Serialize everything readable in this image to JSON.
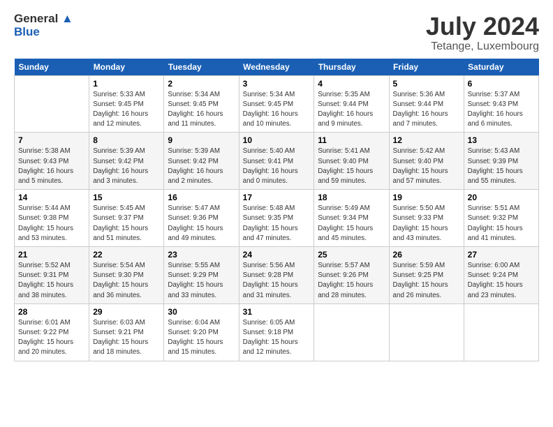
{
  "header": {
    "logo_general": "General",
    "logo_blue": "Blue",
    "title": "July 2024",
    "subtitle": "Tetange, Luxembourg"
  },
  "calendar": {
    "weekdays": [
      "Sunday",
      "Monday",
      "Tuesday",
      "Wednesday",
      "Thursday",
      "Friday",
      "Saturday"
    ],
    "weeks": [
      [
        {
          "day": "",
          "info": ""
        },
        {
          "day": "1",
          "info": "Sunrise: 5:33 AM\nSunset: 9:45 PM\nDaylight: 16 hours\nand 12 minutes."
        },
        {
          "day": "2",
          "info": "Sunrise: 5:34 AM\nSunset: 9:45 PM\nDaylight: 16 hours\nand 11 minutes."
        },
        {
          "day": "3",
          "info": "Sunrise: 5:34 AM\nSunset: 9:45 PM\nDaylight: 16 hours\nand 10 minutes."
        },
        {
          "day": "4",
          "info": "Sunrise: 5:35 AM\nSunset: 9:44 PM\nDaylight: 16 hours\nand 9 minutes."
        },
        {
          "day": "5",
          "info": "Sunrise: 5:36 AM\nSunset: 9:44 PM\nDaylight: 16 hours\nand 7 minutes."
        },
        {
          "day": "6",
          "info": "Sunrise: 5:37 AM\nSunset: 9:43 PM\nDaylight: 16 hours\nand 6 minutes."
        }
      ],
      [
        {
          "day": "7",
          "info": "Sunrise: 5:38 AM\nSunset: 9:43 PM\nDaylight: 16 hours\nand 5 minutes."
        },
        {
          "day": "8",
          "info": "Sunrise: 5:39 AM\nSunset: 9:42 PM\nDaylight: 16 hours\nand 3 minutes."
        },
        {
          "day": "9",
          "info": "Sunrise: 5:39 AM\nSunset: 9:42 PM\nDaylight: 16 hours\nand 2 minutes."
        },
        {
          "day": "10",
          "info": "Sunrise: 5:40 AM\nSunset: 9:41 PM\nDaylight: 16 hours\nand 0 minutes."
        },
        {
          "day": "11",
          "info": "Sunrise: 5:41 AM\nSunset: 9:40 PM\nDaylight: 15 hours\nand 59 minutes."
        },
        {
          "day": "12",
          "info": "Sunrise: 5:42 AM\nSunset: 9:40 PM\nDaylight: 15 hours\nand 57 minutes."
        },
        {
          "day": "13",
          "info": "Sunrise: 5:43 AM\nSunset: 9:39 PM\nDaylight: 15 hours\nand 55 minutes."
        }
      ],
      [
        {
          "day": "14",
          "info": "Sunrise: 5:44 AM\nSunset: 9:38 PM\nDaylight: 15 hours\nand 53 minutes."
        },
        {
          "day": "15",
          "info": "Sunrise: 5:45 AM\nSunset: 9:37 PM\nDaylight: 15 hours\nand 51 minutes."
        },
        {
          "day": "16",
          "info": "Sunrise: 5:47 AM\nSunset: 9:36 PM\nDaylight: 15 hours\nand 49 minutes."
        },
        {
          "day": "17",
          "info": "Sunrise: 5:48 AM\nSunset: 9:35 PM\nDaylight: 15 hours\nand 47 minutes."
        },
        {
          "day": "18",
          "info": "Sunrise: 5:49 AM\nSunset: 9:34 PM\nDaylight: 15 hours\nand 45 minutes."
        },
        {
          "day": "19",
          "info": "Sunrise: 5:50 AM\nSunset: 9:33 PM\nDaylight: 15 hours\nand 43 minutes."
        },
        {
          "day": "20",
          "info": "Sunrise: 5:51 AM\nSunset: 9:32 PM\nDaylight: 15 hours\nand 41 minutes."
        }
      ],
      [
        {
          "day": "21",
          "info": "Sunrise: 5:52 AM\nSunset: 9:31 PM\nDaylight: 15 hours\nand 38 minutes."
        },
        {
          "day": "22",
          "info": "Sunrise: 5:54 AM\nSunset: 9:30 PM\nDaylight: 15 hours\nand 36 minutes."
        },
        {
          "day": "23",
          "info": "Sunrise: 5:55 AM\nSunset: 9:29 PM\nDaylight: 15 hours\nand 33 minutes."
        },
        {
          "day": "24",
          "info": "Sunrise: 5:56 AM\nSunset: 9:28 PM\nDaylight: 15 hours\nand 31 minutes."
        },
        {
          "day": "25",
          "info": "Sunrise: 5:57 AM\nSunset: 9:26 PM\nDaylight: 15 hours\nand 28 minutes."
        },
        {
          "day": "26",
          "info": "Sunrise: 5:59 AM\nSunset: 9:25 PM\nDaylight: 15 hours\nand 26 minutes."
        },
        {
          "day": "27",
          "info": "Sunrise: 6:00 AM\nSunset: 9:24 PM\nDaylight: 15 hours\nand 23 minutes."
        }
      ],
      [
        {
          "day": "28",
          "info": "Sunrise: 6:01 AM\nSunset: 9:22 PM\nDaylight: 15 hours\nand 20 minutes."
        },
        {
          "day": "29",
          "info": "Sunrise: 6:03 AM\nSunset: 9:21 PM\nDaylight: 15 hours\nand 18 minutes."
        },
        {
          "day": "30",
          "info": "Sunrise: 6:04 AM\nSunset: 9:20 PM\nDaylight: 15 hours\nand 15 minutes."
        },
        {
          "day": "31",
          "info": "Sunrise: 6:05 AM\nSunset: 9:18 PM\nDaylight: 15 hours\nand 12 minutes."
        },
        {
          "day": "",
          "info": ""
        },
        {
          "day": "",
          "info": ""
        },
        {
          "day": "",
          "info": ""
        }
      ]
    ]
  }
}
